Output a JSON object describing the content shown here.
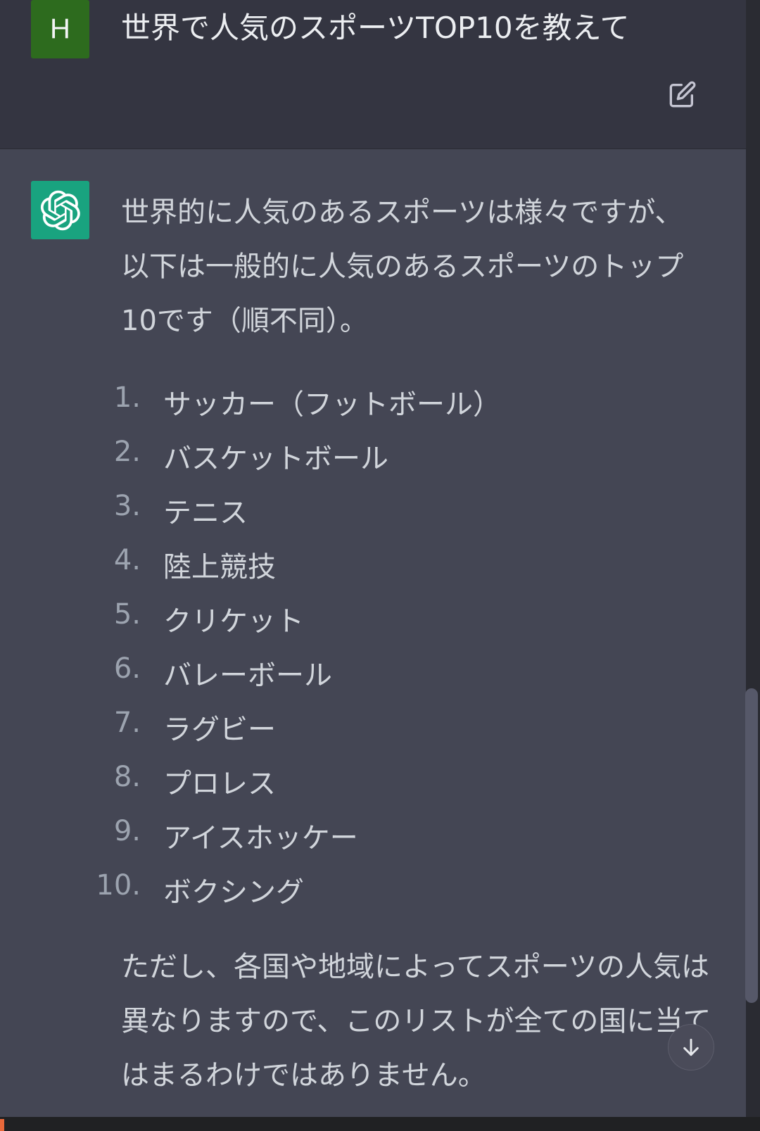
{
  "conversation": {
    "user": {
      "avatar_letter": "H",
      "message": "世界で人気のスポーツTOP10を教えて"
    },
    "assistant": {
      "intro": "世界的に人気のあるスポーツは様々ですが、以下は一般的に人気のあるスポーツのトップ10です（順不同）。",
      "list": [
        {
          "num": "1.",
          "text": "サッカー（フットボール）"
        },
        {
          "num": "2.",
          "text": "バスケットボール"
        },
        {
          "num": "3.",
          "text": "テニス"
        },
        {
          "num": "4.",
          "text": "陸上競技"
        },
        {
          "num": "5.",
          "text": "クリケット"
        },
        {
          "num": "6.",
          "text": "バレーボール"
        },
        {
          "num": "7.",
          "text": "ラグビー"
        },
        {
          "num": "8.",
          "text": "プロレス"
        },
        {
          "num": "9.",
          "text": "アイスホッケー"
        },
        {
          "num": "10.",
          "text": "ボクシング"
        }
      ],
      "outro": "ただし、各国や地域によってスポーツの人気は異なりますので、このリストが全ての国に当てはまるわけではありません。"
    }
  },
  "icons": {
    "edit": "edit-icon",
    "assistant_logo": "openai-logo-icon",
    "scroll_down": "arrow-down-icon"
  },
  "colors": {
    "user_bg": "#343541",
    "assistant_bg": "#444654",
    "user_avatar": "#2d6b1e",
    "assistant_avatar": "#19a37f"
  }
}
